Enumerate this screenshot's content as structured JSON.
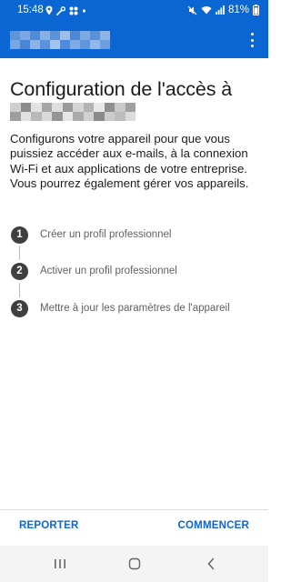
{
  "status_bar": {
    "time": "15:48",
    "battery": "81%",
    "left_icons": [
      "location-icon",
      "tools-icon",
      "grid-icon",
      "dot-icon"
    ],
    "right_icons": [
      "mute-icon",
      "wifi-icon",
      "signal-icon",
      "battery-icon"
    ]
  },
  "app_bar": {
    "overflow_icon": "more-vertical-icon"
  },
  "main": {
    "heading": "Configuration de l'accès à",
    "intro": "Configurons votre appareil pour que vous puissiez accéder aux e-mails, à la connexion Wi-Fi et aux applications de votre entreprise. Vous pourrez également gérer vos appareils.",
    "steps": [
      {
        "number": "1",
        "label": "Créer un profil professionnel"
      },
      {
        "number": "2",
        "label": "Activer un profil professionnel"
      },
      {
        "number": "3",
        "label": "Mettre à jour les paramètres de l'appareil"
      }
    ]
  },
  "footer": {
    "left_button": "REPORTER",
    "right_button": "COMMENCER"
  },
  "nav_bar": {
    "items": [
      "recent-apps-icon",
      "home-icon",
      "back-icon"
    ]
  },
  "colors": {
    "brand_blue": "#0a66d2",
    "text": "#1b1b1b",
    "step_circle": "#3f3f3f",
    "step_text": "#616161"
  }
}
